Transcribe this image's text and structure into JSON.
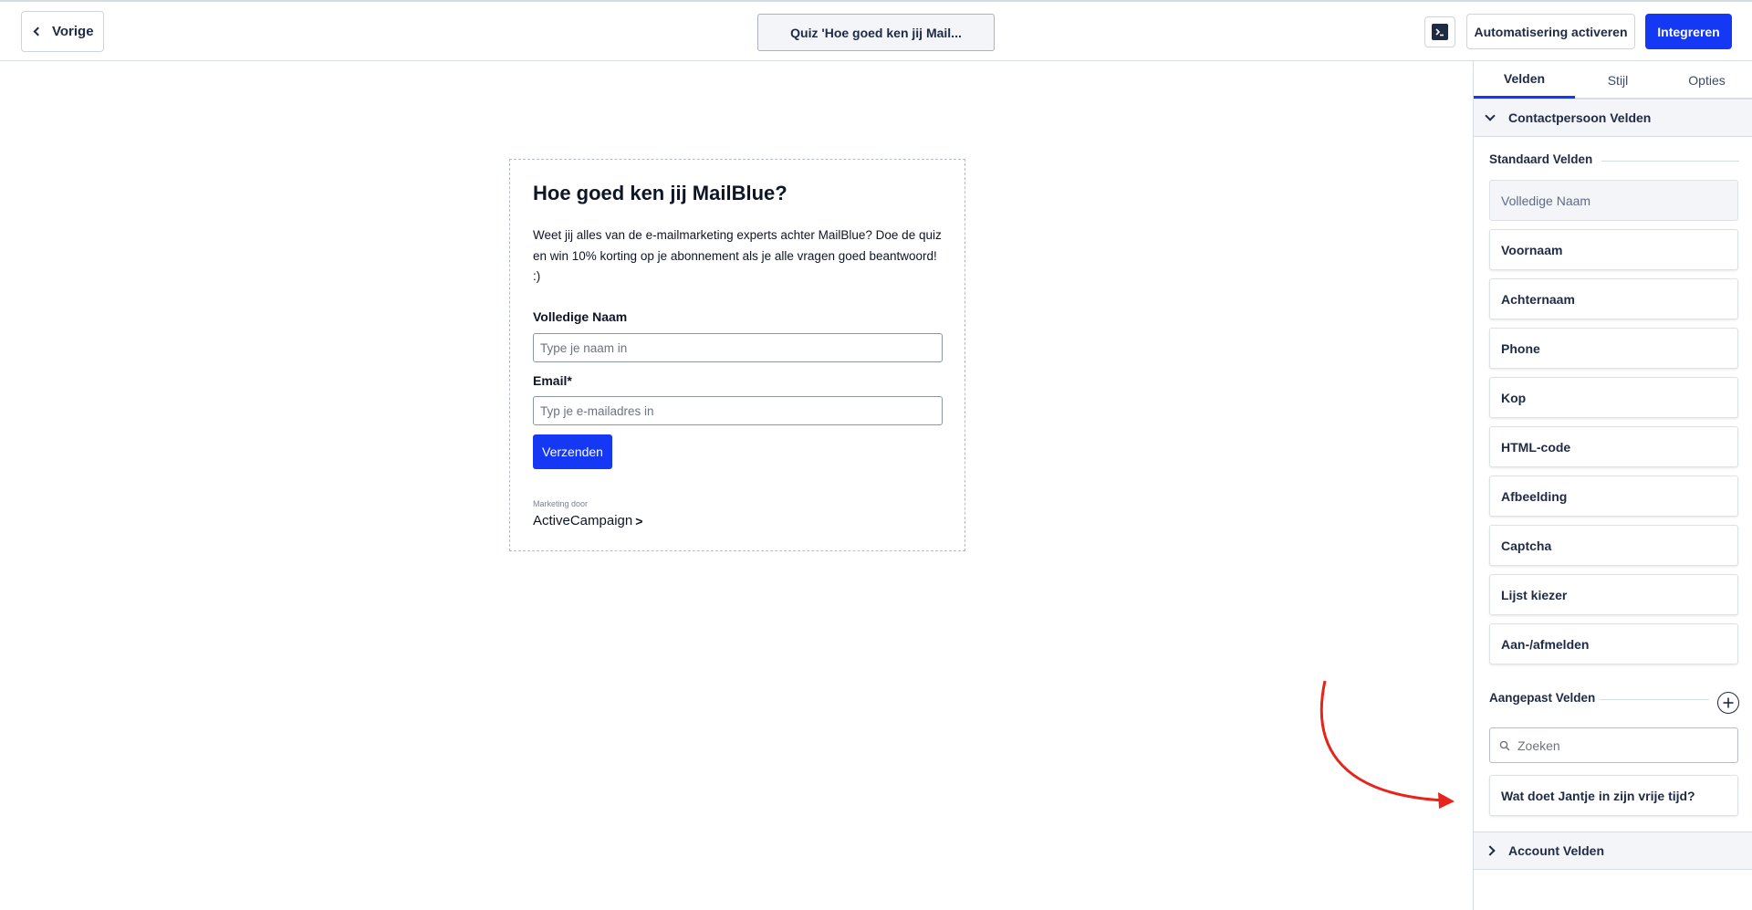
{
  "header": {
    "back_label": "Vorige",
    "form_title": "Quiz 'Hoe goed ken jij Mail...",
    "automation_label": "Automatisering activeren",
    "integrate_label": "Integreren",
    "terminal_icon": "terminal-icon"
  },
  "form": {
    "title": "Hoe goed ken jij MailBlue?",
    "description": "Weet jij alles van de e-mailmarketing experts achter MailBlue? Doe de quiz en win 10% korting op je abonnement als je alle vragen goed beantwoord! :)",
    "name_label": "Volledige Naam",
    "name_placeholder": "Type je naam in",
    "email_label": "Email*",
    "email_placeholder": "Typ je e-mailadres in",
    "submit_label": "Verzenden",
    "marketing_small": "Marketing door",
    "marketing_brand": "ActiveCampaign",
    "marketing_arrow": ">"
  },
  "sidebar": {
    "tabs": [
      {
        "label": "Velden",
        "active": true
      },
      {
        "label": "Stijl",
        "active": false
      },
      {
        "label": "Opties",
        "active": false
      }
    ],
    "contact_section": "Contactpersoon Velden",
    "standard_title": "Standaard Velden",
    "standard_fields": [
      {
        "label": "Volledige Naam",
        "disabled": true
      },
      {
        "label": "Voornaam",
        "disabled": false
      },
      {
        "label": "Achternaam",
        "disabled": false
      },
      {
        "label": "Phone",
        "disabled": false
      },
      {
        "label": "Kop",
        "disabled": false
      },
      {
        "label": "HTML-code",
        "disabled": false
      },
      {
        "label": "Afbeelding",
        "disabled": false
      },
      {
        "label": "Captcha",
        "disabled": false
      },
      {
        "label": "Lijst kiezer",
        "disabled": false
      },
      {
        "label": "Aan-/afmelden",
        "disabled": false
      }
    ],
    "custom_title": "Aangepast Velden",
    "search_placeholder": "Zoeken",
    "custom_fields": [
      {
        "label": "Wat doet Jantje in zijn vrije tijd?"
      }
    ],
    "account_section": "Account Velden"
  },
  "colors": {
    "primary": "#1538f5",
    "text": "#1f2a44",
    "border": "#d7dbe2",
    "annotation": "#e8231a"
  }
}
